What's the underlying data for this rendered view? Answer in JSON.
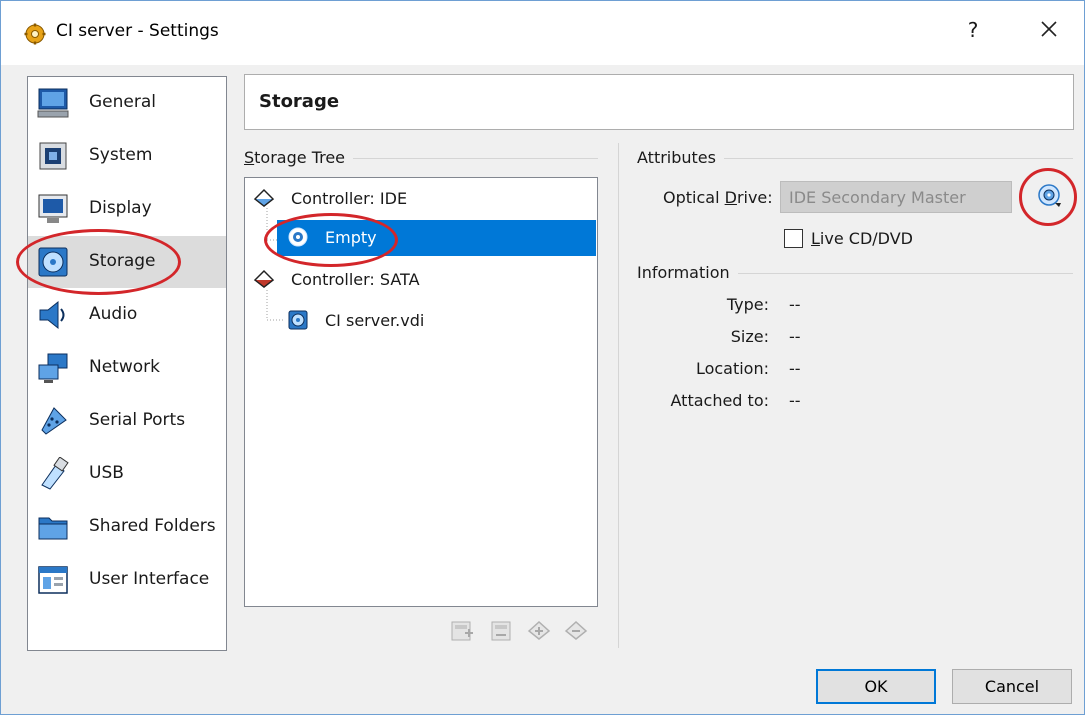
{
  "window": {
    "title": "CI server - Settings",
    "help": "?",
    "close": "close-icon"
  },
  "sidebar": {
    "items": [
      {
        "label": "General",
        "icon": "monitor-icon"
      },
      {
        "label": "System",
        "icon": "chip-icon"
      },
      {
        "label": "Display",
        "icon": "display-icon"
      },
      {
        "label": "Storage",
        "icon": "storage-disk-icon",
        "selected": true
      },
      {
        "label": "Audio",
        "icon": "speaker-icon"
      },
      {
        "label": "Network",
        "icon": "network-icon"
      },
      {
        "label": "Serial Ports",
        "icon": "serial-port-icon"
      },
      {
        "label": "USB",
        "icon": "usb-icon"
      },
      {
        "label": "Shared Folders",
        "icon": "folder-icon"
      },
      {
        "label": "User Interface",
        "icon": "window-icon"
      }
    ]
  },
  "panel": {
    "title": "Storage"
  },
  "storage_tree": {
    "label_first": "S",
    "label_rest": "torage Tree",
    "rows": [
      {
        "label": "Controller: IDE",
        "icon": "ide-controller-icon"
      },
      {
        "label": "Empty",
        "icon": "optical-disc-icon",
        "selected": true
      },
      {
        "label": "Controller: SATA",
        "icon": "sata-controller-icon"
      },
      {
        "label": "CI server.vdi",
        "icon": "hard-disk-icon"
      }
    ],
    "toolbar": [
      "add-controller-icon",
      "remove-controller-icon",
      "add-attachment-icon",
      "remove-attachment-icon"
    ]
  },
  "attributes": {
    "label": "Attributes",
    "optical_drive_label_a": "Optical ",
    "optical_drive_label_u": "D",
    "optical_drive_label_b": "rive:",
    "optical_drive_value": "IDE Secondary Master",
    "choose_disc_icon": "choose-disc-icon",
    "live_cd_u": "L",
    "live_cd_rest": "ive CD/DVD",
    "live_cd_checked": false
  },
  "information": {
    "label": "Information",
    "rows": [
      {
        "key": "Type:",
        "value": "--"
      },
      {
        "key": "Size:",
        "value": "--"
      },
      {
        "key": "Location:",
        "value": "--"
      },
      {
        "key": "Attached to:",
        "value": "--"
      }
    ]
  },
  "buttons": {
    "ok": "OK",
    "cancel": "Cancel"
  },
  "colors": {
    "selection": "#0078d7",
    "annotation": "#d3262a"
  }
}
